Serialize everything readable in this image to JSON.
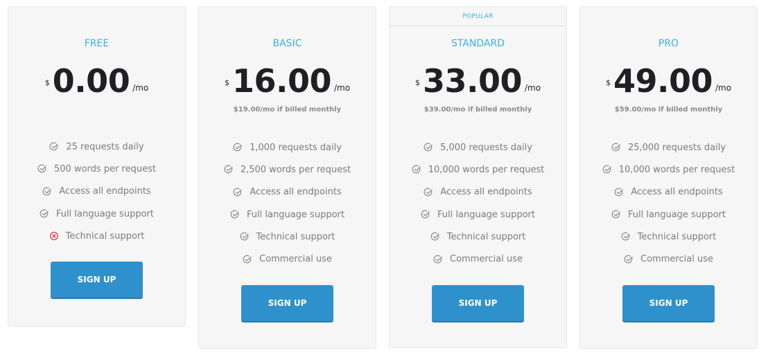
{
  "colors": {
    "accent": "#3bb0dc",
    "button": "#2f91cc",
    "card_bg": "#f6f6f6",
    "price": "#1f2024",
    "feature_text": "#7b7b7b",
    "cross": "#e53950"
  },
  "plans": [
    {
      "name": "FREE",
      "currency": "$",
      "amount": "0.00",
      "per": "/mo",
      "billed_note": "",
      "features": [
        {
          "text": "25 requests daily",
          "icon": "check-circle-icon"
        },
        {
          "text": "500 words per request",
          "icon": "check-circle-icon"
        },
        {
          "text": "Access all endpoints",
          "icon": "check-circle-icon"
        },
        {
          "text": "Full language support",
          "icon": "check-circle-icon"
        },
        {
          "text": "Technical support",
          "icon": "x-circle-icon"
        }
      ],
      "button": "SIGN UP"
    },
    {
      "name": "BASIC",
      "currency": "$",
      "amount": "16.00",
      "per": "/mo",
      "billed_note": "$19.00/mo if billed monthly",
      "features": [
        {
          "text": "1,000 requests daily",
          "icon": "check-circle-icon"
        },
        {
          "text": "2,500 words per request",
          "icon": "check-circle-icon"
        },
        {
          "text": "Access all endpoints",
          "icon": "check-circle-icon"
        },
        {
          "text": "Full language support",
          "icon": "check-circle-icon"
        },
        {
          "text": "Technical support",
          "icon": "check-circle-icon"
        },
        {
          "text": "Commercial use",
          "icon": "check-circle-icon"
        }
      ],
      "button": "SIGN UP"
    },
    {
      "badge": "POPULAR",
      "name": "STANDARD",
      "currency": "$",
      "amount": "33.00",
      "per": "/mo",
      "billed_note": "$39.00/mo if billed monthly",
      "features": [
        {
          "text": "5,000 requests daily",
          "icon": "check-circle-icon"
        },
        {
          "text": "10,000 words per request",
          "icon": "check-circle-icon"
        },
        {
          "text": "Access all endpoints",
          "icon": "check-circle-icon"
        },
        {
          "text": "Full language support",
          "icon": "check-circle-icon"
        },
        {
          "text": "Technical support",
          "icon": "check-circle-icon"
        },
        {
          "text": "Commercial use",
          "icon": "check-circle-icon"
        }
      ],
      "button": "SIGN UP"
    },
    {
      "name": "PRO",
      "currency": "$",
      "amount": "49.00",
      "per": "/mo",
      "billed_note": "$59.00/mo if billed monthly",
      "features": [
        {
          "text": "25,000 requests daily",
          "icon": "check-circle-icon"
        },
        {
          "text": "10,000 words per request",
          "icon": "check-circle-icon"
        },
        {
          "text": "Access all endpoints",
          "icon": "check-circle-icon"
        },
        {
          "text": "Full language support",
          "icon": "check-circle-icon"
        },
        {
          "text": "Technical support",
          "icon": "check-circle-icon"
        },
        {
          "text": "Commercial use",
          "icon": "check-circle-icon"
        }
      ],
      "button": "SIGN UP"
    }
  ]
}
